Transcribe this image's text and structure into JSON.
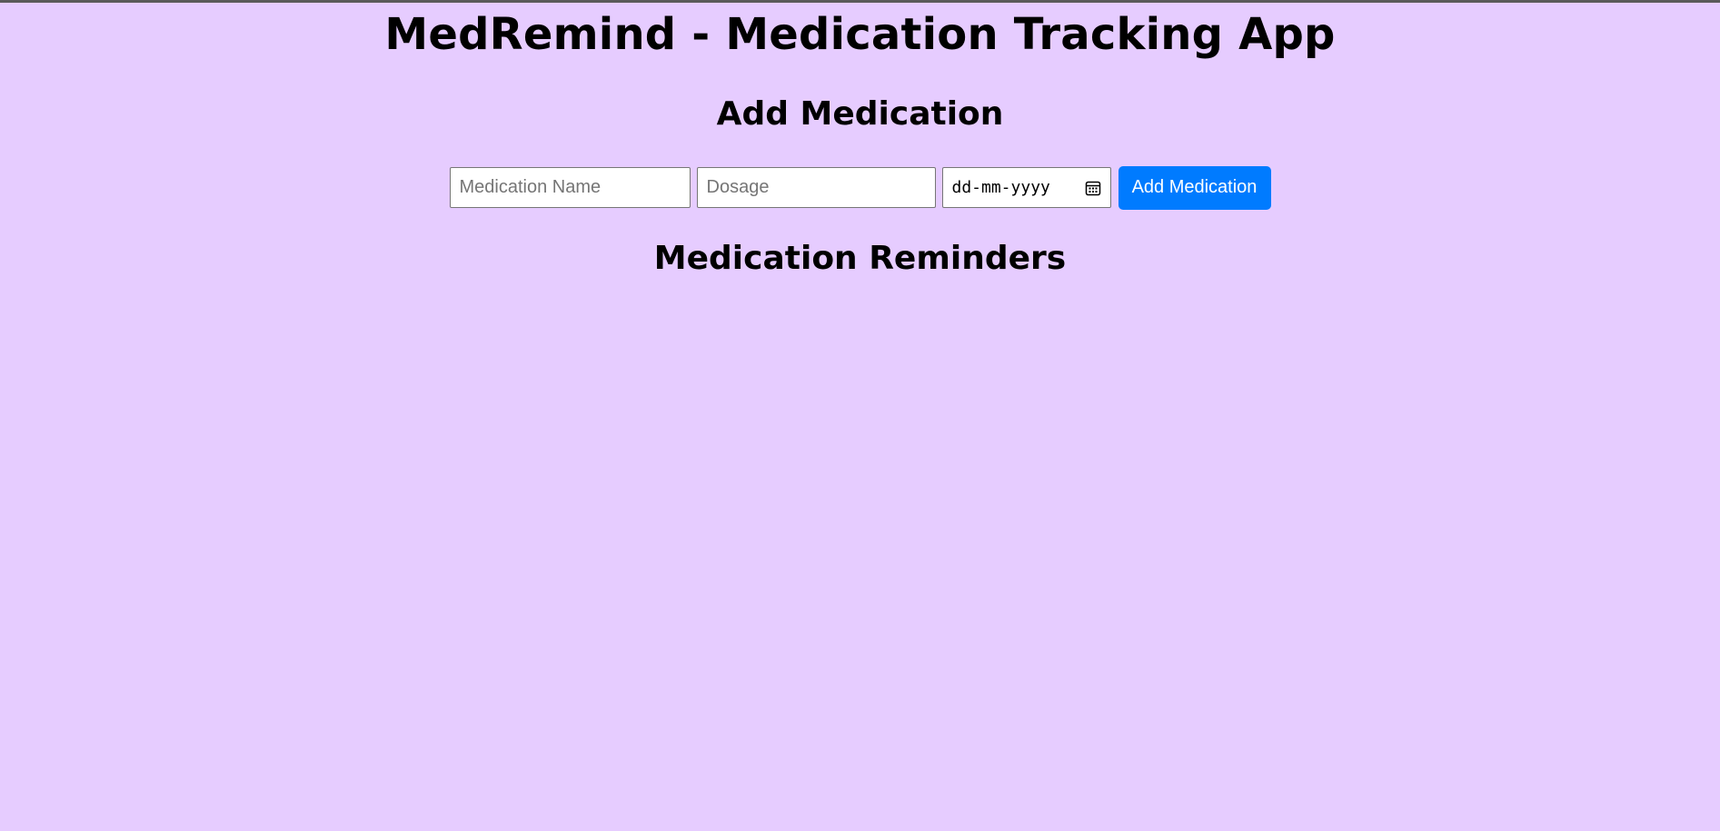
{
  "app": {
    "title": "MedRemind - Medication Tracking App"
  },
  "add_section": {
    "title": "Add Medication",
    "name_input": {
      "placeholder": "Medication Name",
      "value": ""
    },
    "dosage_input": {
      "placeholder": "Dosage",
      "value": ""
    },
    "date_input": {
      "display": "dd-mm-yyyy",
      "icon": "calendar-icon"
    },
    "add_button_label": "Add Medication"
  },
  "reminders_section": {
    "title": "Medication Reminders",
    "items": []
  },
  "colors": {
    "background": "#e6ccff",
    "button": "#007bff",
    "button_text": "#ffffff"
  }
}
